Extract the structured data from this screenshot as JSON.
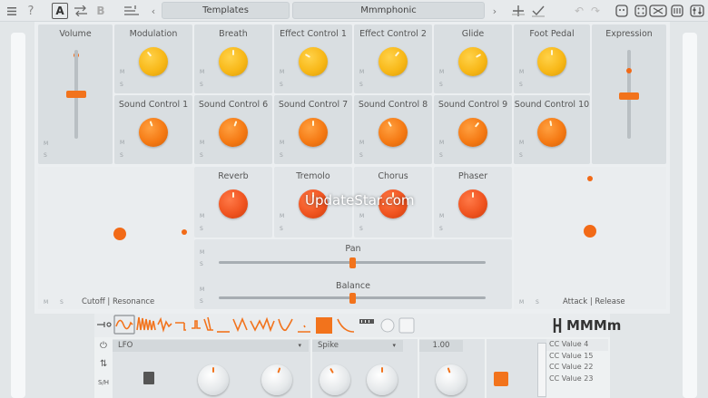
{
  "toolbar": {
    "mode_a": "A",
    "mode_b": "B",
    "templates_label": "Templates",
    "preset_name": "Mmmphonic"
  },
  "controls": {
    "volume": {
      "label": "Volume",
      "level": 0.64
    },
    "expression": {
      "label": "Expression",
      "level": 0.6
    },
    "knobs_row1": [
      {
        "label": "Modulation",
        "color": "yellow"
      },
      {
        "label": "Breath",
        "color": "yellow"
      },
      {
        "label": "Effect Control 1",
        "color": "yellow"
      },
      {
        "label": "Effect Control 2",
        "color": "yellow"
      },
      {
        "label": "Glide",
        "color": "yellow"
      },
      {
        "label": "Foot Pedal",
        "color": "yellow"
      }
    ],
    "knobs_row2": [
      {
        "label": "Sound Control 1",
        "color": "orange"
      },
      {
        "label": "Sound Control 6",
        "color": "orange"
      },
      {
        "label": "Sound Control 7",
        "color": "orange"
      },
      {
        "label": "Sound Control 8",
        "color": "orange"
      },
      {
        "label": "Sound Control 9",
        "color": "orange"
      },
      {
        "label": "Sound Control 10",
        "color": "orange"
      }
    ],
    "knobs_row3": [
      {
        "label": "Reverb",
        "color": "red"
      },
      {
        "label": "Tremolo",
        "color": "red"
      },
      {
        "label": "Chorus",
        "color": "red"
      },
      {
        "label": "Phaser",
        "color": "red"
      }
    ],
    "pan": {
      "label": "Pan",
      "value": 0.5
    },
    "balance": {
      "label": "Balance",
      "value": 0.5
    },
    "xy_left": {
      "label": "Cutoff | Resonance"
    },
    "xy_right": {
      "label": "Attack | Release"
    },
    "m_label": "M",
    "s_label": "S"
  },
  "watermark": "UpdateStar.com",
  "lfo": {
    "brand": "MMMm",
    "type": "LFO",
    "shape": "Spike",
    "rate_value": "1.00",
    "sh_label": "S/H",
    "cc_values": [
      "CC Value 4",
      "CC Value 15",
      "CC Value 22",
      "CC Value 23"
    ]
  },
  "colors": {
    "accent": "#f2731c",
    "knob_yellow": "#f8b818",
    "knob_red": "#f05420"
  }
}
